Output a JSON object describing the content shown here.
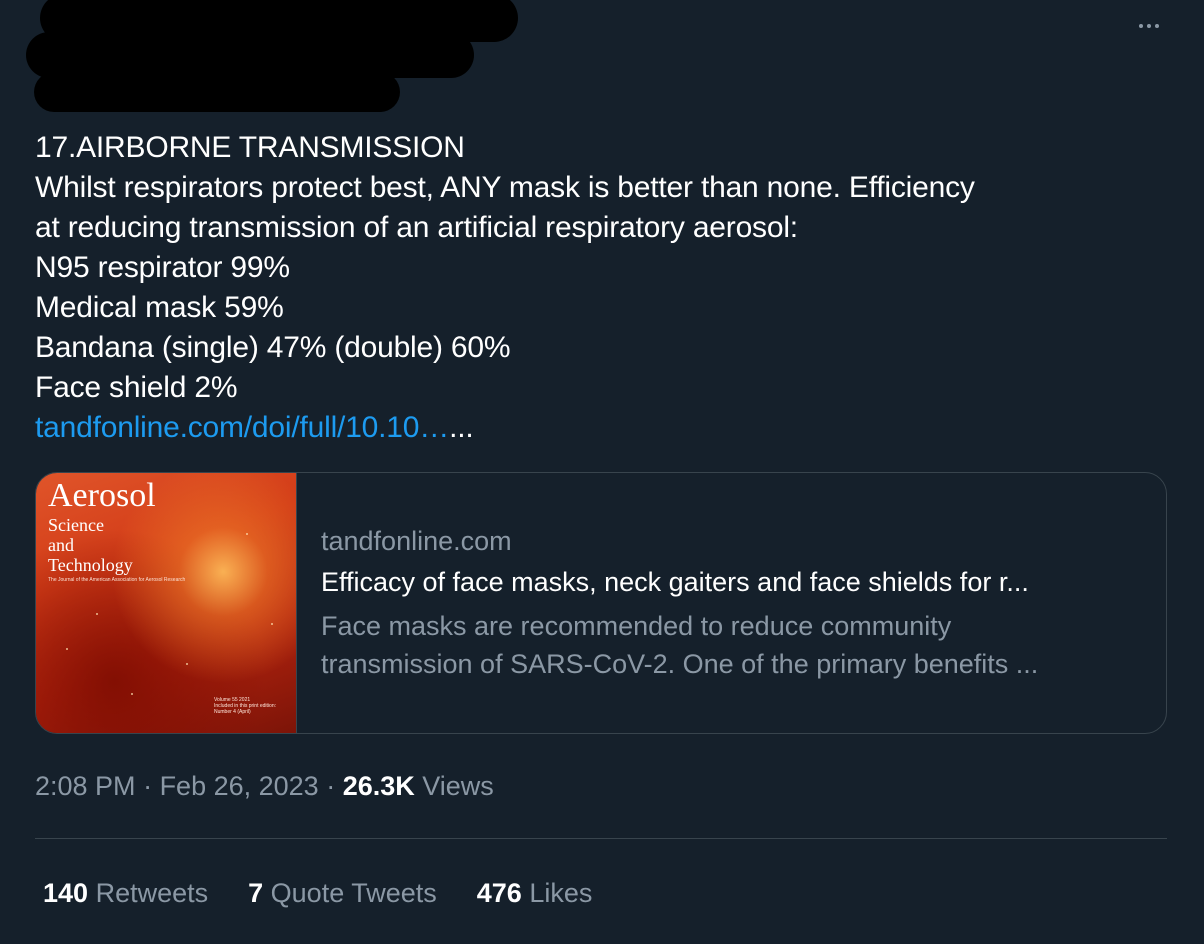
{
  "tweet": {
    "lines": [
      "17.AIRBORNE TRANSMISSION",
      "Whilst respirators protect best, ANY mask is better than none. Efficiency",
      "at reducing transmission of an artificial respiratory aerosol:",
      "N95 respirator 99%",
      "Medical mask 59%",
      "Bandana (single) 47% (double) 60%",
      "Face shield 2%"
    ],
    "link_text": "tandfonline.com/doi/full/10.10…",
    "link_suffix": "...",
    "more_icon": "more-dots-icon"
  },
  "card": {
    "image": {
      "title": "Aerosol",
      "sub1": "Science",
      "sub2": "and",
      "sub3": "Technology",
      "fine": "The Journal of the American Association for Aerosol Research",
      "vol1": "Volume 55 2021",
      "vol2": "Included in this print edition:",
      "vol3": "Number 4 (April)"
    },
    "domain": "tandfonline.com",
    "title": "Efficacy of face masks, neck gaiters and face shields for r...",
    "desc_line1": "Face masks are recommended to reduce community",
    "desc_line2": "transmission of SARS-CoV-2. One of the primary benefits ..."
  },
  "meta": {
    "time": "2:08 PM",
    "sep1": " · ",
    "date": "Feb 26, 2023",
    "sep2": " · ",
    "views_count": "26.3K",
    "views_label": " Views"
  },
  "stats": {
    "retweets_count": "140",
    "retweets_label": " Retweets",
    "quotes_count": "7",
    "quotes_label": " Quote Tweets",
    "likes_count": "476",
    "likes_label": " Likes"
  },
  "colors": {
    "background": "#15202b",
    "link": "#1d9bf0",
    "muted": "#8b98a5",
    "border": "#38444d"
  }
}
